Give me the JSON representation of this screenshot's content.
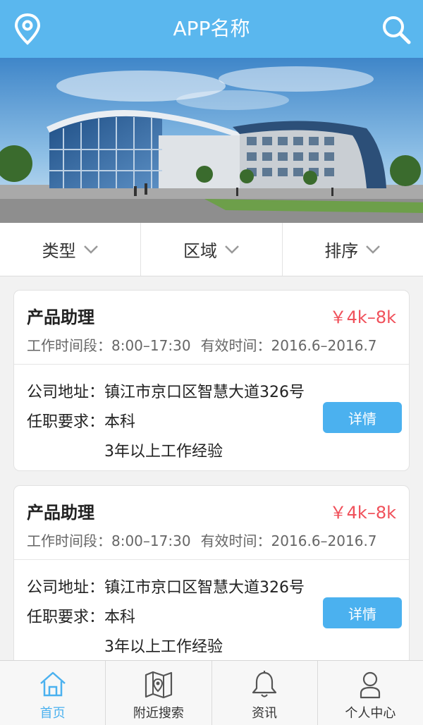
{
  "header": {
    "title": "APP名称",
    "left_icon": "location-pin-icon",
    "right_icon": "search-icon",
    "color": "#5ab7ee"
  },
  "filters": [
    {
      "label": "类型"
    },
    {
      "label": "区域"
    },
    {
      "label": "排序"
    }
  ],
  "jobs": [
    {
      "title": "产品助理",
      "salary": "￥4k–8k",
      "work_time": "工作时间段：8:00–17:30",
      "valid_time": "有效时间：2016.6–2016.7",
      "address_label": "公司地址：",
      "address": "镇江市京口区智慧大道326号",
      "req_label": "任职要求：",
      "req_edu": "本科",
      "req_exp": "3年以上工作经验",
      "detail_button": "详情"
    },
    {
      "title": "产品助理",
      "salary": "￥4k–8k",
      "work_time": "工作时间段：8:00–17:30",
      "valid_time": "有效时间：2016.6–2016.7",
      "address_label": "公司地址：",
      "address": "镇江市京口区智慧大道326号",
      "req_label": "任职要求：",
      "req_edu": "本科",
      "req_exp": "3年以上工作经验",
      "detail_button": "详情"
    }
  ],
  "tabbar": [
    {
      "label": "首页",
      "icon": "home-icon",
      "active": true
    },
    {
      "label": "附近搜索",
      "icon": "map-icon",
      "active": false
    },
    {
      "label": "资讯",
      "icon": "bell-icon",
      "active": false
    },
    {
      "label": "个人中心",
      "icon": "user-icon",
      "active": false
    }
  ],
  "colors": {
    "accent": "#4bb1ef",
    "salary": "#f0505a"
  }
}
